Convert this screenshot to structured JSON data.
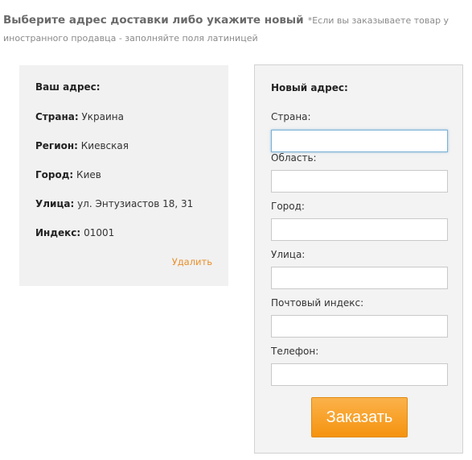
{
  "header": {
    "title": "Выберите адрес доставки либо укажите новый",
    "note": "*Если вы заказываете товар у иностранного продавца - заполняйте поля латиницей"
  },
  "saved_address": {
    "title": "Ваш адрес:",
    "rows": [
      {
        "label": "Страна:",
        "value": "Украина"
      },
      {
        "label": "Регион:",
        "value": "Киевская"
      },
      {
        "label": "Город:",
        "value": "Киев"
      },
      {
        "label": "Улица:",
        "value": "ул. Энтузиастов 18, 31"
      },
      {
        "label": "Индекс:",
        "value": "01001"
      }
    ],
    "delete_label": "Удалить"
  },
  "new_address": {
    "title": "Новый адрес:",
    "fields": [
      {
        "label": "Страна:",
        "value": ""
      },
      {
        "label": "Область:",
        "value": ""
      },
      {
        "label": "Город:",
        "value": ""
      },
      {
        "label": "Улица:",
        "value": ""
      },
      {
        "label": "Почтовый индекс:",
        "value": ""
      },
      {
        "label": "Телефон:",
        "value": ""
      }
    ],
    "submit_label": "Заказать"
  },
  "colors": {
    "accent": "#f5930f",
    "link": "#e8902c",
    "focus_border": "#7ab1d6"
  }
}
